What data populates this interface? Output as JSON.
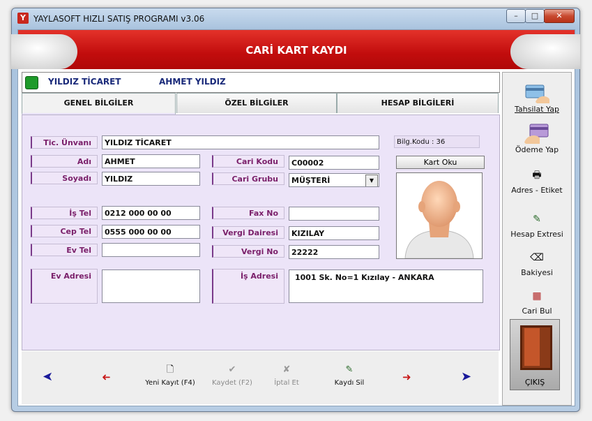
{
  "window": {
    "title": "YAYLASOFT HIZLI SATIŞ PROGRAMI v3.06",
    "min_glyph": "–",
    "max_glyph": "□",
    "close_glyph": "✕",
    "app_icon_glyph": "Y"
  },
  "banner": {
    "title": "CARİ KART KAYDI"
  },
  "infobar": {
    "company": "YILDIZ TİCARET",
    "person": "AHMET   YILDIZ"
  },
  "tabs": [
    {
      "label": "GENEL BİLGİLER",
      "active": true
    },
    {
      "label": "ÖZEL BİLGİLER",
      "active": false
    },
    {
      "label": "HESAP BİLGİLERİ",
      "active": false
    }
  ],
  "form": {
    "tic_unvani": {
      "label": "Tic. Ünvanı",
      "value": "YILDIZ TİCARET"
    },
    "adi": {
      "label": "Adı",
      "value": "AHMET"
    },
    "soyadi": {
      "label": "Soyadı",
      "value": "YILDIZ"
    },
    "cari_kodu": {
      "label": "Cari Kodu",
      "value": "C00002"
    },
    "cari_grubu": {
      "label": "Cari Grubu",
      "value": "MÜŞTERİ"
    },
    "is_tel": {
      "label": "İş Tel",
      "value": "0212 000 00 00"
    },
    "cep_tel": {
      "label": "Cep Tel",
      "value": "0555 000 00 00"
    },
    "ev_tel": {
      "label": "Ev Tel",
      "value": ""
    },
    "fax_no": {
      "label": "Fax No",
      "value": ""
    },
    "vergi_dairesi": {
      "label": "Vergi Dairesi",
      "value": "KIZILAY"
    },
    "vergi_no": {
      "label": "Vergi No",
      "value": "22222"
    },
    "ev_adresi": {
      "label": "Ev Adresi",
      "value": ""
    },
    "is_adresi": {
      "label": "İş Adresi",
      "value": "1001 Sk. No=1 Kızılay - ANKARA"
    },
    "bilg_kodu": "Bilg.Kodu : 36",
    "kart_oku": "Kart Oku"
  },
  "bottom_bar": {
    "first": "➤",
    "prev": "➜",
    "new_record": "Yeni Kayıt (F4)",
    "save": "Kaydet (F2)",
    "cancel": "İptal Et",
    "delete": "Kaydı Sil",
    "next": "➜",
    "last": "➤"
  },
  "sidebar": {
    "tahsilat": "Tahsilat Yap",
    "odeme": "Ödeme Yap",
    "adres": "Adres - Etiket",
    "hesap_extresi": "Hesap Extresi",
    "bakiyesi": "Bakiyesi",
    "cari_bul": "Cari Bul",
    "cikis": "ÇIKIŞ"
  },
  "colors": {
    "banner_red": "#c20d0d",
    "form_bg": "#ece4f8",
    "label_text": "#7a1f6a",
    "name_text": "#1a2a7a",
    "nav_blue": "#1a1a9a",
    "nav_red": "#c81818"
  }
}
